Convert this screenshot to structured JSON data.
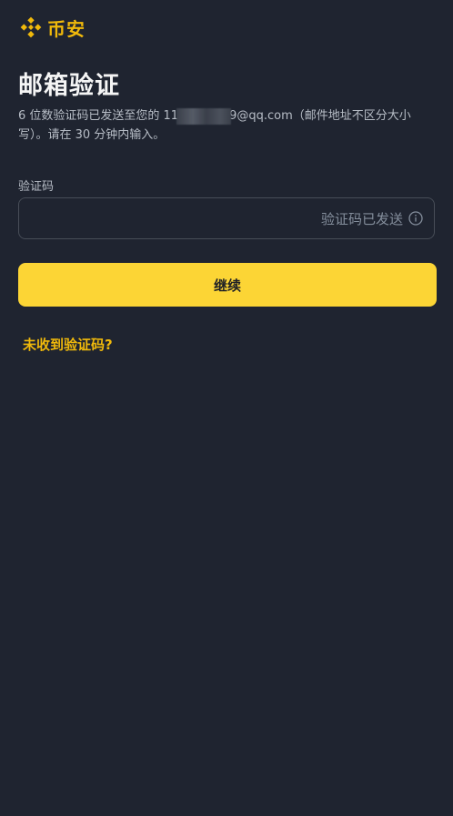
{
  "brand": {
    "name": "币安",
    "color": "#f0b90b",
    "icon": "binance-logo-icon"
  },
  "page": {
    "title": "邮箱验证",
    "description_prefix": "6 位数验证码已发送至您的 11",
    "description_suffix": "9@qq.com（邮件地址不区分大小写）。请在 30 分钟内输入。"
  },
  "form": {
    "code_label": "验证码",
    "code_value": "",
    "code_placeholder": "",
    "sent_status": "验证码已发送",
    "info_icon": "info-circle-icon"
  },
  "actions": {
    "continue_label": "继续",
    "continue_color": "#fcd535",
    "resend_link": "未收到验证码?"
  },
  "colors": {
    "background": "#1f2430",
    "text_primary": "#eaecef",
    "text_secondary": "#b7bdc6",
    "muted": "#848e9c"
  }
}
